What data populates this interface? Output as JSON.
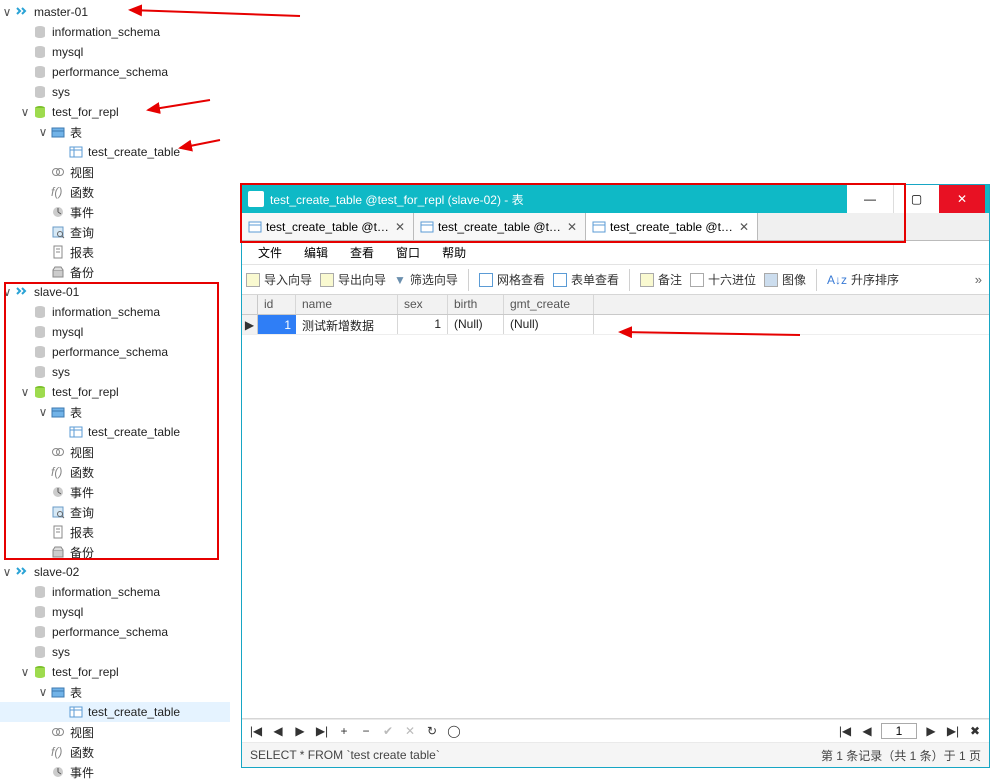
{
  "tree": {
    "servers": [
      {
        "name": "master-01",
        "dbs": [
          "information_schema",
          "mysql",
          "performance_schema",
          "sys"
        ],
        "repl_db": "test_for_repl",
        "repl": {
          "tables_folder": "表",
          "table": "test_create_table",
          "nodes": [
            "视图",
            "函数",
            "事件",
            "查询",
            "报表",
            "备份"
          ]
        }
      },
      {
        "name": "slave-01",
        "dbs": [
          "information_schema",
          "mysql",
          "performance_schema",
          "sys"
        ],
        "repl_db": "test_for_repl",
        "repl": {
          "tables_folder": "表",
          "table": "test_create_table",
          "nodes": [
            "视图",
            "函数",
            "事件",
            "查询",
            "报表",
            "备份"
          ]
        }
      },
      {
        "name": "slave-02",
        "dbs": [
          "information_schema",
          "mysql",
          "performance_schema",
          "sys"
        ],
        "repl_db": "test_for_repl",
        "repl": {
          "tables_folder": "表",
          "table": "test_create_table",
          "nodes": [
            "视图",
            "函数",
            "事件"
          ]
        }
      }
    ]
  },
  "window": {
    "title": "test_create_table @test_for_repl (slave-02) - 表",
    "tabs": [
      {
        "label": "test_create_table @test...",
        "active": false
      },
      {
        "label": "test_create_table @test...",
        "active": false
      },
      {
        "label": "test_create_table @test...",
        "active": true
      }
    ],
    "menu": [
      "文件",
      "编辑",
      "查看",
      "窗口",
      "帮助"
    ],
    "toolbar": {
      "import": "导入向导",
      "export": "导出向导",
      "filter": "筛选向导",
      "gridview": "网格查看",
      "formview": "表单查看",
      "note": "备注",
      "hex": "十六进位",
      "image": "图像",
      "sort": "升序排序"
    },
    "grid": {
      "columns": [
        "id",
        "name",
        "sex",
        "birth",
        "gmt_create"
      ],
      "rows": [
        {
          "id": "1",
          "name": "测试新增数据",
          "sex": "1",
          "birth": "(Null)",
          "gmt_create": "(Null)"
        }
      ]
    },
    "nav": {
      "page": "1"
    },
    "status": {
      "sql": "SELECT * FROM `test create table`",
      "info": "第 1 条记录（共 1 条）于 1 页"
    }
  }
}
